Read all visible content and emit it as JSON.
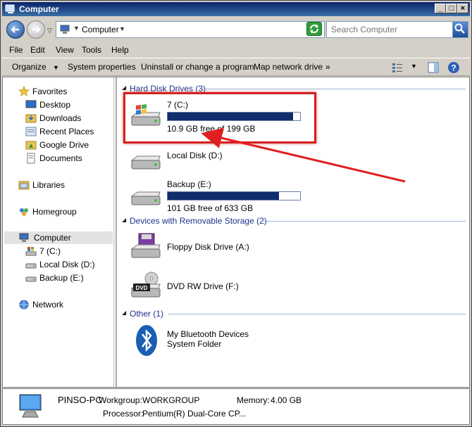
{
  "window": {
    "title": "Computer"
  },
  "address": {
    "crumb": "Computer",
    "search_placeholder": "Search Computer"
  },
  "menu": [
    "File",
    "Edit",
    "View",
    "Tools",
    "Help"
  ],
  "toolbar": {
    "organize": "Organize",
    "system_properties": "System properties",
    "uninstall": "Uninstall or change a program",
    "map_drive": "Map network drive",
    "more": "»"
  },
  "sidebar": {
    "favorites": "Favorites",
    "desktop": "Desktop",
    "downloads": "Downloads",
    "recent_places": "Recent Places",
    "google_drive": "Google Drive",
    "documents": "Documents",
    "libraries": "Libraries",
    "homegroup": "Homegroup",
    "computer": "Computer",
    "drive_c": "7 (C:)",
    "drive_d": "Local Disk (D:)",
    "drive_e": "Backup (E:)",
    "network": "Network"
  },
  "groups": {
    "hdd": "Hard Disk Drives (3)",
    "removable": "Devices with Removable Storage (2)",
    "other": "Other (1)"
  },
  "drives": [
    {
      "name": "7 (C:)",
      "free_text": "10.9 GB free of 199 GB",
      "used_fraction": 0.945
    },
    {
      "name": "Local Disk (D:)"
    },
    {
      "name": "Backup (E:)",
      "free_text": "101 GB free of 633 GB",
      "used_fraction": 0.84
    }
  ],
  "removable": [
    {
      "name": "Floppy Disk Drive (A:)"
    },
    {
      "name": "DVD RW Drive (F:)",
      "badge": "DVD"
    }
  ],
  "other": [
    {
      "name": "My Bluetooth Devices",
      "sub": "System Folder"
    }
  ],
  "status": {
    "pc_name": "PINSO-PC",
    "workgroup_label": "Workgroup:",
    "workgroup_value": "WORKGROUP",
    "memory_label": "Memory:",
    "memory_value": "4.00 GB",
    "processor_label": "Processor:",
    "processor_value": "Pentium(R) Dual-Core  CP..."
  },
  "colors": {
    "highlight": "#d42020",
    "bar_fill": "#0f2e6b",
    "group_text": "#1e3287"
  }
}
